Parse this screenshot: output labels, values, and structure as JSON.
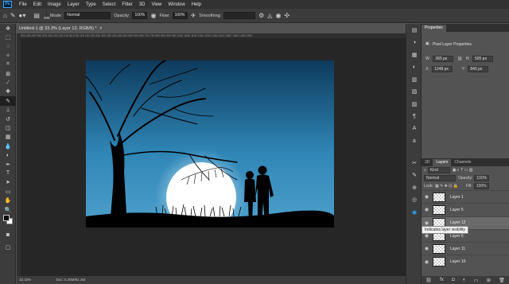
{
  "app": {
    "logo": "Ps",
    "menu": [
      "File",
      "Edit",
      "Image",
      "Layer",
      "Type",
      "Select",
      "Filter",
      "3D",
      "View",
      "Window",
      "Help"
    ]
  },
  "options": {
    "brush_size": "200",
    "mode_label": "Mode:",
    "mode_value": "Normal",
    "opacity_label": "Opacity:",
    "opacity_value": "100%",
    "flow_label": "Flow:",
    "flow_value": "100%",
    "smoothing_label": "Smoothing:",
    "smoothing_value": ""
  },
  "document": {
    "tab_title": "Untitled-1 @ 33.3% (Layer 12, RGB/8) *",
    "ruler_ticks": "500   450   400   350   300   250   200   150   100   50   0   50   100   150   200   250   300   350   400   450   500   550   600   650   700   750   800   850   900   950   1000  1050  1100  1150  1200  1250  1300  1350  1400  1450  1500",
    "zoom": "33.33%",
    "doc_size": "Doc: 5.36M/91.3M"
  },
  "properties": {
    "tab": "Properties",
    "title": "Pixel Layer Properties",
    "w_label": "W:",
    "w_value": "365 px",
    "h_label": "H:",
    "h_value": "505 px",
    "x_label": "X:",
    "x_value": "1248 px",
    "y_label": "Y:",
    "y_value": "840 px"
  },
  "layers": {
    "tabs": [
      "3D",
      "Layers",
      "Channels"
    ],
    "kind": "Kind",
    "blend": "Normal",
    "opacity_label": "Opacity:",
    "opacity_value": "100%",
    "lock_label": "Lock:",
    "fill_label": "Fill:",
    "fill_value": "100%",
    "items": [
      {
        "name": "Layer 1",
        "selected": false
      },
      {
        "name": "Layer 5",
        "selected": false
      },
      {
        "name": "Layer 12",
        "selected": true
      },
      {
        "name": "Layer 6",
        "selected": false
      },
      {
        "name": "Layer 11",
        "selected": false
      },
      {
        "name": "Layer 10",
        "selected": false
      }
    ],
    "tooltip": "Indicates layer visibility"
  },
  "colors": {
    "sky_top": "#0e3a5c",
    "sky_mid": "#2f86b6",
    "sky_bottom": "#4fa0cc",
    "moon": "#ffffff",
    "silhouette": "#000000",
    "accent": "#31a8ff"
  }
}
